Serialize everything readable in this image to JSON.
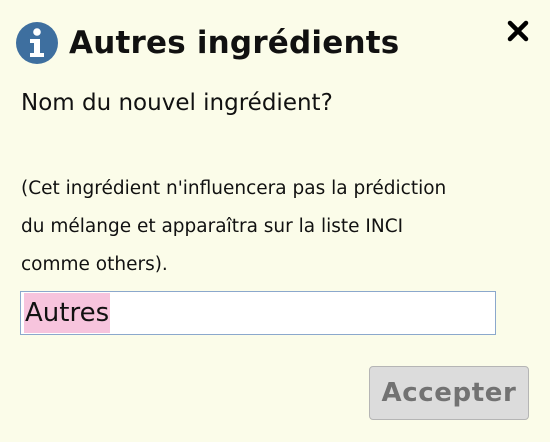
{
  "dialog": {
    "title": "Autres ingrédients",
    "title_icon": "info-icon",
    "close_icon": "close-icon",
    "question": "Nom du nouvel ingrédient?",
    "note_lines": [
      "(Cet ingrédient n'influencera pas la prédiction",
      "du mélange et apparaîtra sur la liste INCI",
      "comme others)."
    ],
    "input": {
      "value": "Autres",
      "selected": true
    },
    "accept_label": "Accepter"
  },
  "colors": {
    "background": "#fbfce9",
    "icon_blue": "#3e6f9f",
    "selection_pink": "#f7c4dd",
    "input_border": "#8ba8cc",
    "button_bg": "#dcdcdc",
    "button_text": "#727272"
  }
}
